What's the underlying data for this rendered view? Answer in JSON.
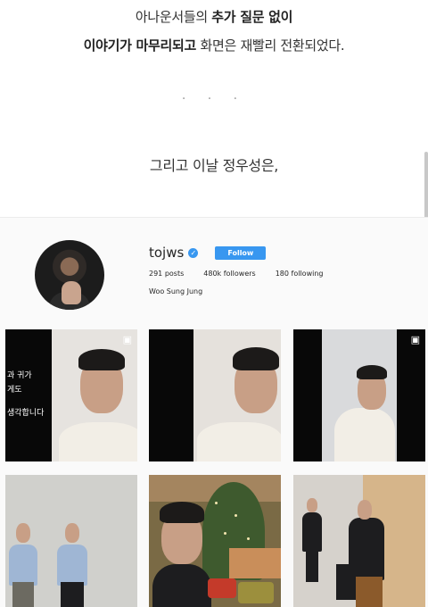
{
  "article": {
    "line1_plain": "아나운서들의 ",
    "line1_bold": "추가 질문 없이",
    "line2_bold": "이야기가 마무리되고",
    "line2_plain": " 화면은 재빨리 전환되었다.",
    "dots": "· · ·",
    "line3": "그리고 이날 정우성은,"
  },
  "profile": {
    "username": "tojws",
    "verified_badge": "✓",
    "follow_label": "Follow",
    "posts_count": "291",
    "posts_label": " posts",
    "followers_count": "480k",
    "followers_label": " followers",
    "following_count": "180",
    "following_label": " following",
    "full_name": "Woo Sung Jung"
  },
  "posts": [
    {
      "subtitle_lines": [
        "과 귀가",
        "게도",
        "생각합니다"
      ],
      "video": true
    },
    {
      "video": false
    },
    {
      "video": true
    },
    {
      "video": false
    },
    {
      "video": false
    },
    {
      "video": false
    }
  ],
  "icons": {
    "video": "video-camera-icon",
    "verified": "verified-check-icon"
  },
  "colors": {
    "accent": "#3897f0",
    "text": "#262626",
    "background": "#fafafa"
  }
}
